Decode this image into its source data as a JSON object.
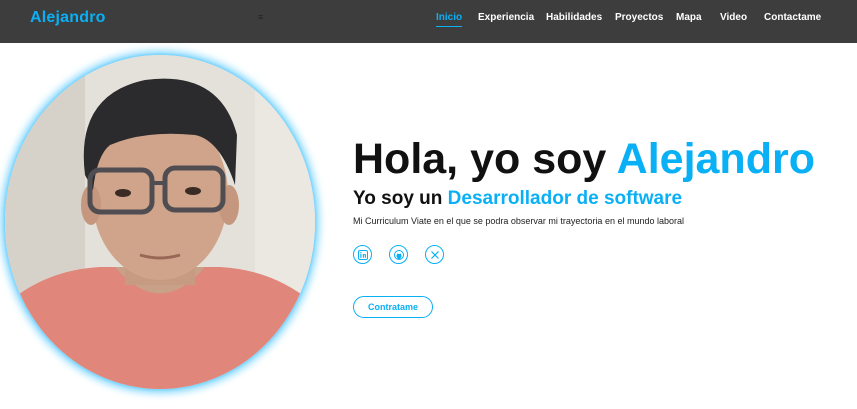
{
  "brand": {
    "name": "Alejandro"
  },
  "nav": {
    "toggle_icon": "≡",
    "items": [
      {
        "label": "Inicio",
        "active": true
      },
      {
        "label": "Experiencia"
      },
      {
        "label": "Habilidades"
      },
      {
        "label": "Proyectos"
      },
      {
        "label": "Mapa"
      },
      {
        "label": "Video"
      },
      {
        "label": "Contactame"
      }
    ]
  },
  "hero": {
    "greeting": "Hola, yo soy ",
    "name": "Alejandro",
    "role_prefix": "Yo soy un ",
    "role": "Desarrollador de software",
    "description": "Mi Curriculum Viate en el que se podra observar mi trayectoria en el mundo laboral",
    "cta_label": "Contratame",
    "social": [
      {
        "icon": "linkedin-icon"
      },
      {
        "icon": "github-icon"
      },
      {
        "icon": "x-twitter-icon"
      }
    ]
  },
  "colors": {
    "accent": "#0ab0f5",
    "navbar": "#3d3d3d"
  }
}
